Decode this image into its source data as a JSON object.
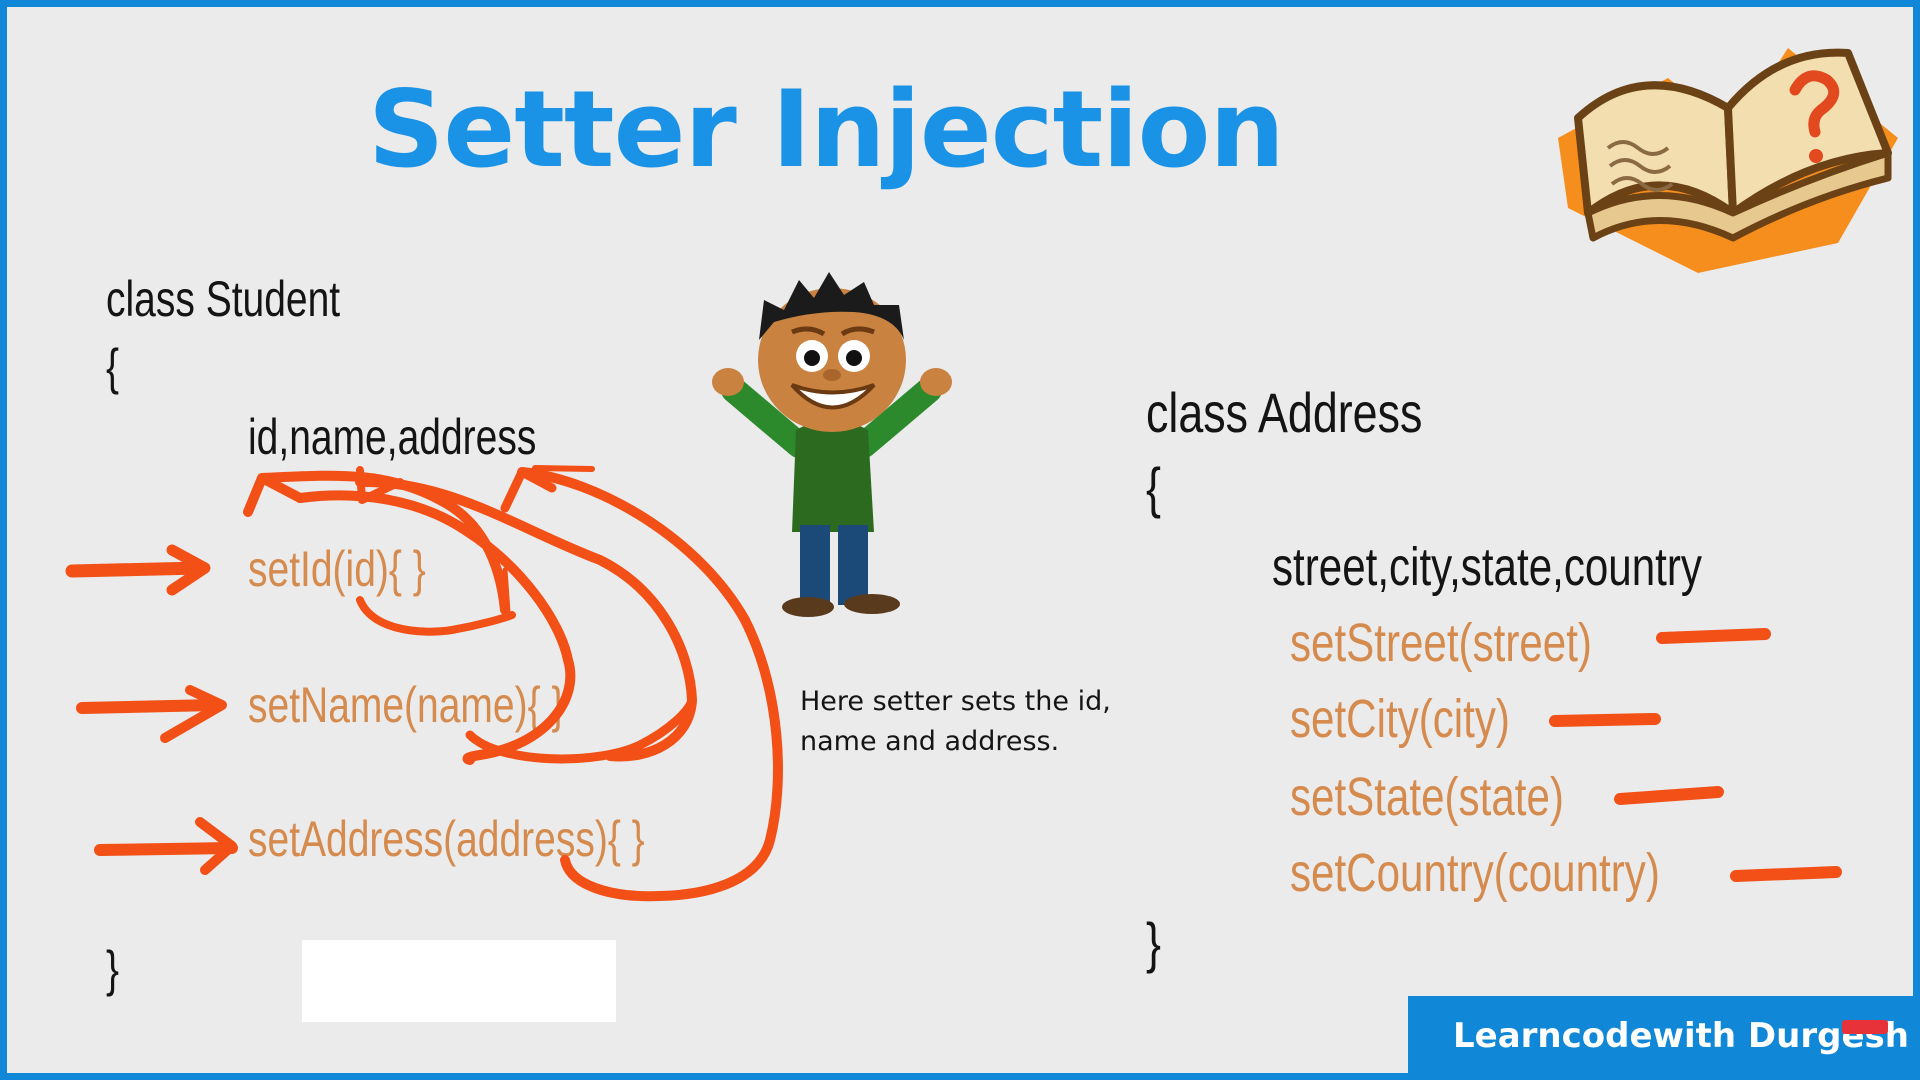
{
  "title": "Setter Injection",
  "student": {
    "class_decl": "class Student",
    "open_brace": "{",
    "fields": "id,name,address",
    "setters": [
      "setId(id){ }",
      "setName(name){ }",
      "setAddress(address){ }"
    ],
    "close_brace": "}"
  },
  "address": {
    "class_decl": "class Address",
    "open_brace": "{",
    "fields": "street,city,state,country",
    "setters": [
      "setStreet(street)",
      "setCity(city)",
      "setState(state)",
      "setCountry(country)"
    ],
    "close_brace": "}"
  },
  "note": "Here setter sets the id, name and address.",
  "brand": "Learncodewith Durgesh",
  "colors": {
    "title": "#1a93e6",
    "code_text": "#141414",
    "setter_text": "#d58a4e",
    "annotation": "#f25016",
    "frame": "#1187d8"
  },
  "icons": [
    "book-question-icon",
    "cartoon-boy-icon",
    "subscribe-badge-icon"
  ]
}
